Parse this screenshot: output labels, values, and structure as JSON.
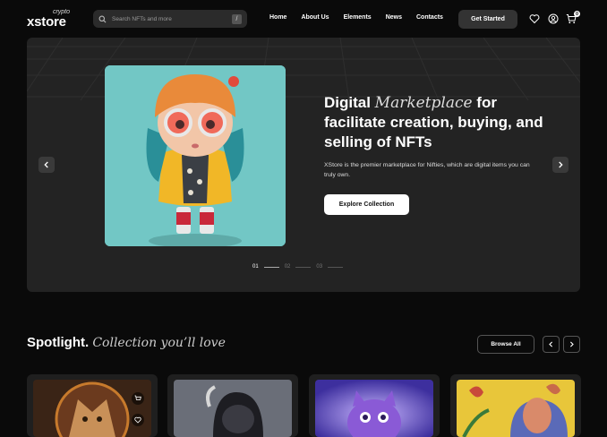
{
  "logo": {
    "small": "crypto",
    "big": "xstore"
  },
  "search": {
    "placeholder": "Search NFTs and more",
    "shortcut": "/"
  },
  "nav": {
    "items": [
      "Home",
      "About Us",
      "Elements",
      "News",
      "Contacts"
    ]
  },
  "header": {
    "cta_label": "Get Started",
    "cart_count": "0"
  },
  "hero": {
    "title_line1_pre": "Digital ",
    "title_accent": "Marketplace",
    "title_line1_post": " for",
    "title_rest": "facilitate creation, buying, and selling of NFTs",
    "description": "XStore is the premier marketplace for Nifties, which are digital items you can truly own.",
    "cta_label": "Explore Collection",
    "pager": [
      "01",
      "02",
      "03"
    ],
    "active_slide": 1
  },
  "spotlight": {
    "title": "Spotlight.",
    "accent": "Collection you’ll love",
    "browse_label": "Browse All"
  },
  "colors": {
    "background": "#0a0a0a",
    "hero_bg": "#232323",
    "button_dark": "#333333",
    "accent_white": "#ffffff"
  },
  "icons": [
    "search-icon",
    "heart-icon",
    "user-icon",
    "cart-icon",
    "chevron-left-icon",
    "chevron-right-icon"
  ]
}
